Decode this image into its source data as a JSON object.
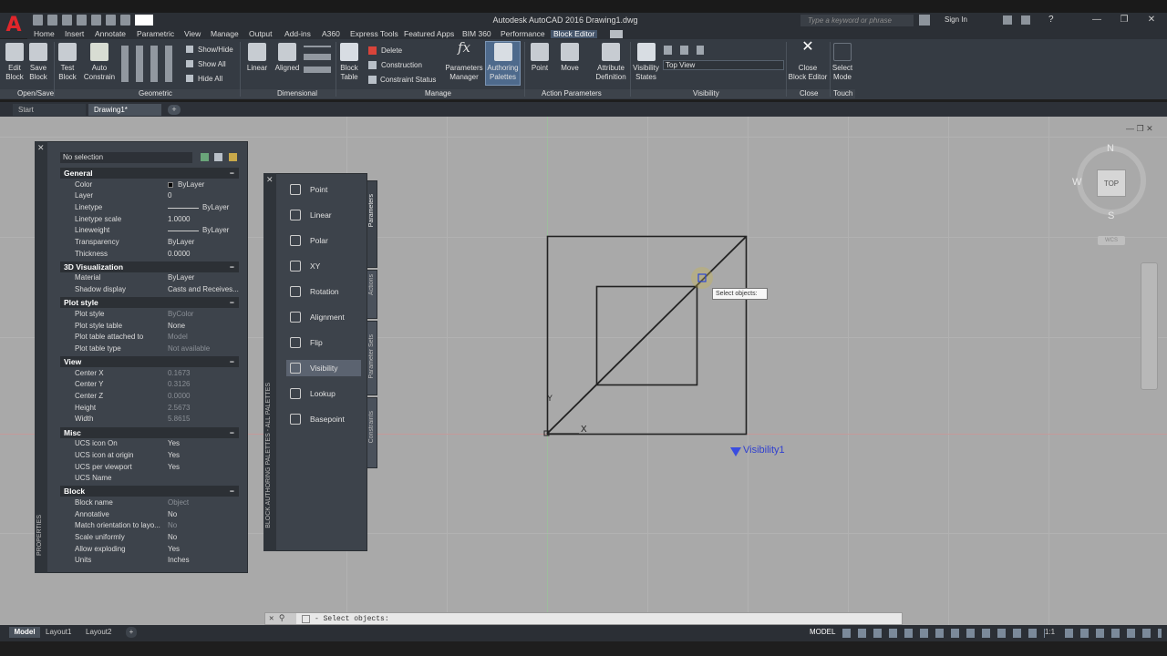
{
  "app": {
    "title": "Autodesk AutoCAD 2016   Drawing1.dwg",
    "search_placeholder": "Type a keyword or phrase",
    "sign_in": "Sign In",
    "help": "?"
  },
  "menu_tabs": [
    "Home",
    "Insert",
    "Annotate",
    "Parametric",
    "View",
    "Manage",
    "Output",
    "Add-ins",
    "A360",
    "Express Tools",
    "Featured Apps",
    "BIM 360",
    "Performance",
    "Block Editor"
  ],
  "ribbon": {
    "opensave": {
      "edit": "Edit\nBlock",
      "save": "Save\nBlock",
      "group": "Open/Save"
    },
    "geometric": {
      "test": "Test\nBlock",
      "auto": "Auto\nConstrain",
      "group": "Geometric"
    },
    "showhide": {
      "show_hide": "Show/Hide",
      "show_all": "Show All",
      "hide_all": "Hide All"
    },
    "dimensional": {
      "linear": "Linear",
      "aligned": "Aligned",
      "group": "Dimensional"
    },
    "manage": {
      "block_table": "Block\nTable",
      "delete": "Delete",
      "construction": "Construction",
      "constraint_status": "Constraint Status",
      "params_manager": "Parameters\nManager",
      "authoring": "Authoring\nPalettes",
      "group": "Manage"
    },
    "action": {
      "point": "Point",
      "move": "Move",
      "attr": "Attribute\nDefinition",
      "group": "Action Parameters"
    },
    "visibility": {
      "states": "Visibility\nStates",
      "current": "Top View",
      "group": "Visibility"
    },
    "close": {
      "close_editor": "Close\nBlock Editor",
      "group": "Close"
    },
    "touch": {
      "select_mode": "Select\nMode",
      "group": "Touch"
    }
  },
  "doc_tabs": {
    "start": "Start",
    "drawing": "Drawing1*"
  },
  "properties": {
    "selection": "No selection",
    "title": "PROPERTIES",
    "sections": [
      {
        "name": "General",
        "rows": [
          {
            "k": "Color",
            "v": "ByLayer"
          },
          {
            "k": "Layer",
            "v": "0"
          },
          {
            "k": "Linetype",
            "v": "ByLayer"
          },
          {
            "k": "Linetype scale",
            "v": "1.0000"
          },
          {
            "k": "Lineweight",
            "v": "ByLayer"
          },
          {
            "k": "Transparency",
            "v": "ByLayer"
          },
          {
            "k": "Thickness",
            "v": "0.0000"
          }
        ]
      },
      {
        "name": "3D Visualization",
        "rows": [
          {
            "k": "Material",
            "v": "ByLayer"
          },
          {
            "k": "Shadow display",
            "v": "Casts  and  Receives..."
          }
        ]
      },
      {
        "name": "Plot style",
        "rows": [
          {
            "k": "Plot style",
            "v": "ByColor"
          },
          {
            "k": "Plot style table",
            "v": "None"
          },
          {
            "k": "Plot table attached to",
            "v": "Model"
          },
          {
            "k": "Plot table type",
            "v": "Not available"
          }
        ]
      },
      {
        "name": "View",
        "rows": [
          {
            "k": "Center X",
            "v": "0.1673"
          },
          {
            "k": "Center Y",
            "v": "0.3126"
          },
          {
            "k": "Center Z",
            "v": "0.0000"
          },
          {
            "k": "Height",
            "v": "2.5673"
          },
          {
            "k": "Width",
            "v": "5.8615"
          }
        ]
      },
      {
        "name": "Misc",
        "rows": [
          {
            "k": "UCS icon On",
            "v": "Yes"
          },
          {
            "k": "UCS icon at origin",
            "v": "Yes"
          },
          {
            "k": "UCS per viewport",
            "v": "Yes"
          },
          {
            "k": "UCS Name",
            "v": ""
          }
        ]
      },
      {
        "name": "Block",
        "rows": [
          {
            "k": "Block name",
            "v": "Object"
          },
          {
            "k": "Annotative",
            "v": "No"
          },
          {
            "k": "Match orientation to layo...",
            "v": "No"
          },
          {
            "k": "Scale uniformly",
            "v": "No"
          },
          {
            "k": "Allow exploding",
            "v": "Yes"
          },
          {
            "k": "Units",
            "v": "Inches"
          }
        ]
      }
    ]
  },
  "palette": {
    "title": "BLOCK AUTHORING PALETTES - ALL PALETTES",
    "items": [
      "Point",
      "Linear",
      "Polar",
      "XY",
      "Rotation",
      "Alignment",
      "Flip",
      "Visibility",
      "Lookup",
      "Basepoint"
    ],
    "tabs": [
      "Parameters",
      "Actions",
      "Parameter Sets",
      "Constraints"
    ]
  },
  "canvas": {
    "tooltip": "Select objects:",
    "visibility_label": "Visibility1",
    "axis_y": "Y",
    "axis_x": "X",
    "viewcube": {
      "top": "TOP",
      "n": "N",
      "s": "S",
      "w": "W",
      "wcs": "WCS"
    }
  },
  "command": {
    "prompt": "Select objects:"
  },
  "status": {
    "model_tab": "Model",
    "layout1": "Layout1",
    "layout2": "Layout2",
    "model_label": "MODEL",
    "scale": "1:1"
  }
}
